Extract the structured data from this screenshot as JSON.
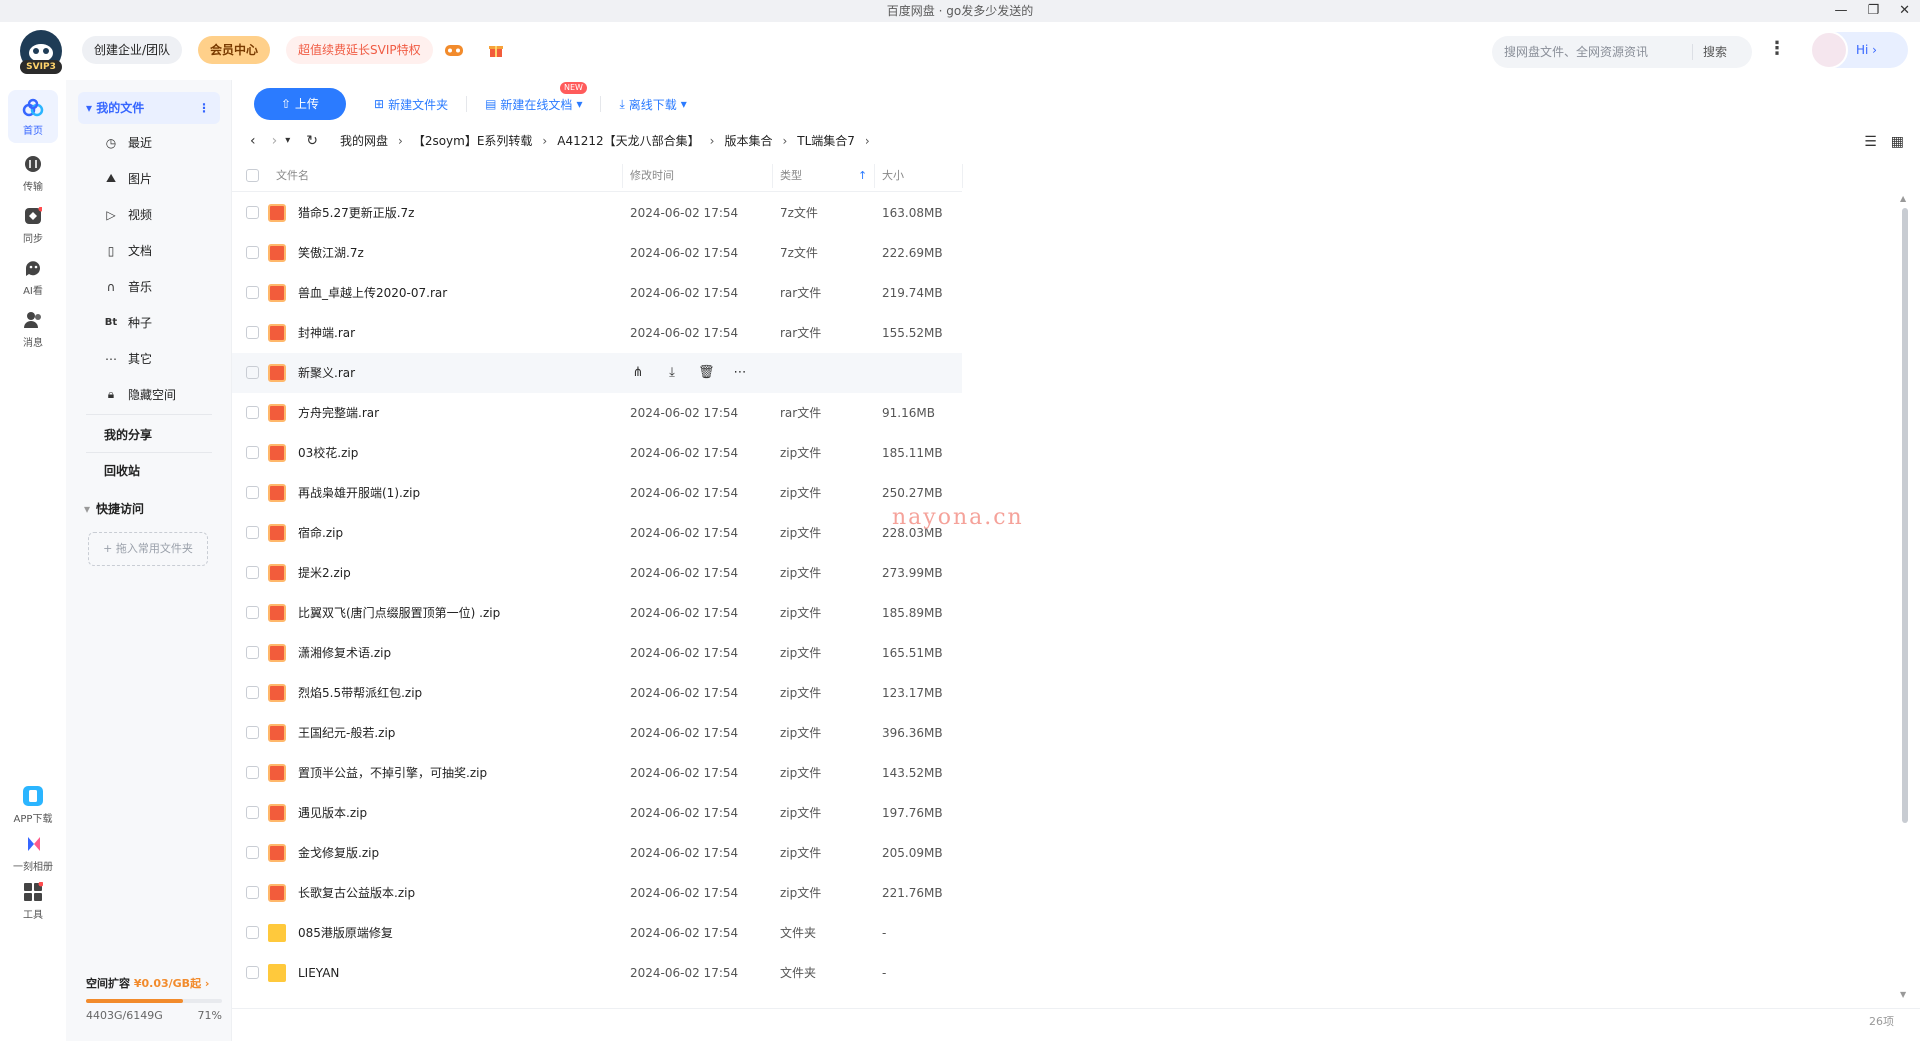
{
  "window": {
    "title": "百度网盘 · go发多少发送的",
    "controls": [
      "—",
      "❐",
      "✕"
    ]
  },
  "topbar": {
    "logo_badge": "SVIP3",
    "team_label": "创建企业/团队",
    "vip_label": "会员中心",
    "svip_label": "超值续费延长SVIP特权",
    "search_placeholder": "搜网盘文件、全网资源资讯",
    "search_button": "搜索",
    "greeting": "Hi ›"
  },
  "rail": [
    {
      "label": "首页",
      "icon": "home-icon",
      "active": true
    },
    {
      "label": "传输",
      "icon": "transfer-icon"
    },
    {
      "label": "同步",
      "icon": "sync-icon"
    },
    {
      "label": "AI看",
      "icon": "ai-icon"
    },
    {
      "label": "消息",
      "icon": "message-icon"
    },
    {
      "label": "APP下载",
      "icon": "app-download-icon"
    },
    {
      "label": "一刻相册",
      "icon": "album-icon"
    },
    {
      "label": "工具",
      "icon": "tools-icon"
    }
  ],
  "sidebar": {
    "my_files": "我的文件",
    "items": [
      {
        "label": "最近",
        "icon": "clock-icon"
      },
      {
        "label": "图片",
        "icon": "image-icon"
      },
      {
        "label": "视频",
        "icon": "video-icon"
      },
      {
        "label": "文档",
        "icon": "document-icon"
      },
      {
        "label": "音乐",
        "icon": "music-icon"
      },
      {
        "label": "种子",
        "icon": "torrent-icon"
      },
      {
        "label": "其它",
        "icon": "more-icon"
      },
      {
        "label": "隐藏空间",
        "icon": "lock-icon"
      }
    ],
    "my_share": "我的分享",
    "recycle": "回收站",
    "quick_access": "快捷访问",
    "drop_hint": "+ 拖入常用文件夹",
    "storage_title": "空间扩容",
    "storage_price": "¥0.03/GB起 ›",
    "storage_used": "4403G/6149G",
    "storage_percent": "71%",
    "storage_fraction": 0.71
  },
  "toolbar": {
    "upload": "上传",
    "new_folder": "新建文件夹",
    "new_doc": "新建在线文档",
    "new_tag": "NEW",
    "offline": "离线下载"
  },
  "breadcrumb": [
    "我的网盘",
    "【2soym】E系列转载",
    "A41212【天龙八部合集】",
    "版本集合",
    "TL端集合7"
  ],
  "table": {
    "headers": {
      "name": "文件名",
      "time": "修改时间",
      "type": "类型",
      "size": "大小"
    },
    "rows": [
      {
        "name": "猎命5.27更新正版.7z",
        "time": "2024-06-02 17:54",
        "type": "7z文件",
        "size": "163.08MB",
        "kind": "archive"
      },
      {
        "name": "笑傲江湖.7z",
        "time": "2024-06-02 17:54",
        "type": "7z文件",
        "size": "222.69MB",
        "kind": "archive"
      },
      {
        "name": "兽血_卓越上传2020-07.rar",
        "time": "2024-06-02 17:54",
        "type": "rar文件",
        "size": "219.74MB",
        "kind": "archive"
      },
      {
        "name": "封神端.rar",
        "time": "2024-06-02 17:54",
        "type": "rar文件",
        "size": "155.52MB",
        "kind": "archive"
      },
      {
        "name": "新聚义.rar",
        "time": "",
        "type": "",
        "size": "",
        "kind": "archive",
        "hover": true
      },
      {
        "name": "方舟完整端.rar",
        "time": "2024-06-02 17:54",
        "type": "rar文件",
        "size": "91.16MB",
        "kind": "archive"
      },
      {
        "name": "03校花.zip",
        "time": "2024-06-02 17:54",
        "type": "zip文件",
        "size": "185.11MB",
        "kind": "archive"
      },
      {
        "name": "再战枭雄开服端(1).zip",
        "time": "2024-06-02 17:54",
        "type": "zip文件",
        "size": "250.27MB",
        "kind": "archive"
      },
      {
        "name": "宿命.zip",
        "time": "2024-06-02 17:54",
        "type": "zip文件",
        "size": "228.03MB",
        "kind": "archive"
      },
      {
        "name": "提米2.zip",
        "time": "2024-06-02 17:54",
        "type": "zip文件",
        "size": "273.99MB",
        "kind": "archive"
      },
      {
        "name": "比翼双飞(唐门点缀服置顶第一位) .zip",
        "time": "2024-06-02 17:54",
        "type": "zip文件",
        "size": "185.89MB",
        "kind": "archive"
      },
      {
        "name": "潇湘修复术语.zip",
        "time": "2024-06-02 17:54",
        "type": "zip文件",
        "size": "165.51MB",
        "kind": "archive"
      },
      {
        "name": "烈焰5.5带帮派红包.zip",
        "time": "2024-06-02 17:54",
        "type": "zip文件",
        "size": "123.17MB",
        "kind": "archive"
      },
      {
        "name": "王国纪元-般若.zip",
        "time": "2024-06-02 17:54",
        "type": "zip文件",
        "size": "396.36MB",
        "kind": "archive"
      },
      {
        "name": "置顶半公益，不掉引擎，可抽奖.zip",
        "time": "2024-06-02 17:54",
        "type": "zip文件",
        "size": "143.52MB",
        "kind": "archive"
      },
      {
        "name": "遇见版本.zip",
        "time": "2024-06-02 17:54",
        "type": "zip文件",
        "size": "197.76MB",
        "kind": "archive"
      },
      {
        "name": "金戈修复版.zip",
        "time": "2024-06-02 17:54",
        "type": "zip文件",
        "size": "205.09MB",
        "kind": "archive"
      },
      {
        "name": "长歌复古公益版本.zip",
        "time": "2024-06-02 17:54",
        "type": "zip文件",
        "size": "221.76MB",
        "kind": "archive"
      },
      {
        "name": "085港版原端修复",
        "time": "2024-06-02 17:54",
        "type": "文件夹",
        "size": "-",
        "kind": "folder"
      },
      {
        "name": "LIEYAN",
        "time": "2024-06-02 17:54",
        "type": "文件夹",
        "size": "-",
        "kind": "folder"
      }
    ]
  },
  "watermark": "nayona.cn",
  "item_count": "26项",
  "colors": {
    "accent": "#2b7bff",
    "vip": "#ffd08a",
    "svip_text": "#f05b43",
    "storage": "#f28b2c"
  }
}
